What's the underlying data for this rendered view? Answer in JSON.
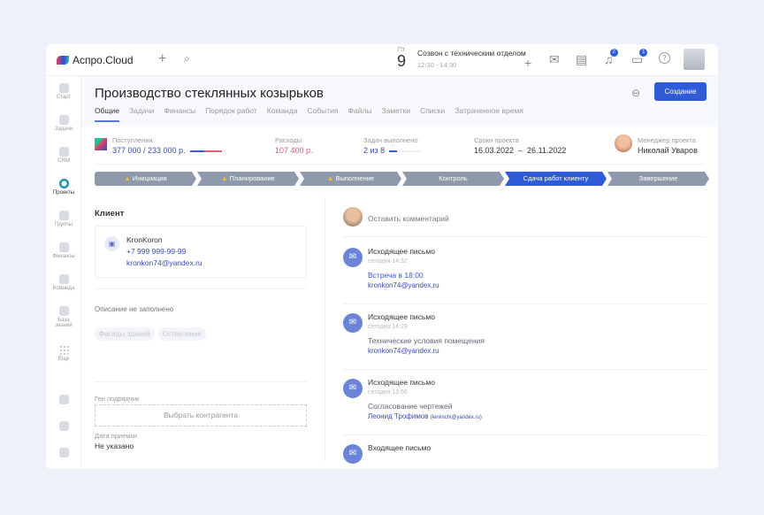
{
  "app": {
    "logo": "Аспро.Cloud"
  },
  "topbar": {
    "day_name": "Пт",
    "day_num": "9",
    "event_title": "Созвон с техническим отделом",
    "event_time": "12:30 - 14:30",
    "notif_count": "2",
    "chat_count": "1"
  },
  "sidebar": {
    "items": [
      {
        "label": "Старт"
      },
      {
        "label": "Задачи"
      },
      {
        "label": "CRM"
      },
      {
        "label": "Проекты"
      },
      {
        "label": "Группы"
      },
      {
        "label": "Финансы"
      },
      {
        "label": "Команда"
      },
      {
        "label": "База знаний"
      },
      {
        "label": "Ещё"
      }
    ]
  },
  "project": {
    "title": "Производство стеклянных козырьков",
    "create_label": "Создание",
    "tabs": [
      "Общие",
      "Задачи",
      "Финансы",
      "Порядок работ",
      "Команда",
      "События",
      "Файлы",
      "Заметки",
      "Списки",
      "Затраченное время"
    ]
  },
  "stats": {
    "income_label": "Поступления",
    "income_value": "377 000 / 233 000 р.",
    "expense_label": "Расходы",
    "expense_value": "107 400 р.",
    "tasks_label": "Задач выполнено",
    "tasks_value": "2 из 8",
    "tasks_progress": 0.25,
    "dates_label": "Сроки проекта",
    "dates_value": "16.03.2022  –  26.11.2022",
    "manager_label": "Менеджер проекта",
    "manager_name": "Николай Уваров"
  },
  "stages": [
    {
      "label": "Инициация",
      "warn": true
    },
    {
      "label": "Планирование",
      "warn": true
    },
    {
      "label": "Выполнение",
      "warn": true
    },
    {
      "label": "Контроль",
      "warn": false
    },
    {
      "label": "Сдача работ клиенту",
      "current": true
    },
    {
      "label": "Завершение",
      "warn": false
    }
  ],
  "client": {
    "heading": "Клиент",
    "name": "KronKoron",
    "phone": "+7 999 999-99-99",
    "email": "kronkon74@yandex.ru",
    "description": "Описание не заполнено",
    "tags": [
      "Фасады зданий",
      "Остекление"
    ],
    "contractor_label": "Ген.подрядчик",
    "contractor_placeholder": "Выбрать контрагента",
    "date_label": "Дата приемки",
    "date_value": "Не указано"
  },
  "feed": {
    "comment_placeholder": "Оставить комментарий",
    "items": [
      {
        "type": "Исходящее письмо",
        "time": "сегодня 14:32",
        "subject": "Встреча в 18:00",
        "contact": "kronkon74@yandex.ru",
        "extra": ""
      },
      {
        "type": "Исходящее письмо",
        "time": "сегодня 14:29",
        "subject": "Технические условия помещения",
        "contact": "kronkon74@yandex.ru",
        "extra": ""
      },
      {
        "type": "Исходящее письмо",
        "time": "сегодня 13:56",
        "subject": "Согласование чертежей",
        "contact": "Леонид Трофимов",
        "extra": "(leninichi@yandex.ru)"
      },
      {
        "type": "Входящее письмо"
      }
    ]
  }
}
